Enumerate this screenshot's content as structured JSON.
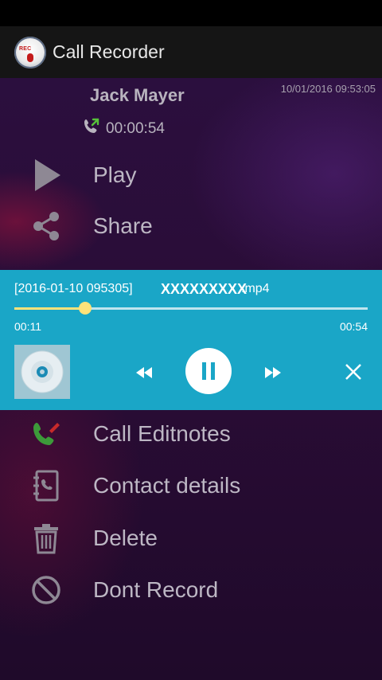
{
  "app": {
    "title": "Call Recorder",
    "logo_text": "REC"
  },
  "record": {
    "caller_name": "Jack Mayer",
    "timestamp": "10/01/2016 09:53:05",
    "duration": "00:00:54"
  },
  "menu": [
    {
      "label": "Play",
      "icon": "play-icon"
    },
    {
      "label": "Share",
      "icon": "share-icon"
    },
    {
      "label": "Call Editnotes",
      "icon": "call-notes-icon"
    },
    {
      "label": "Contact details",
      "icon": "contact-book-icon"
    },
    {
      "label": "Delete",
      "icon": "trash-icon"
    },
    {
      "label": "Dont Record",
      "icon": "block-icon"
    }
  ],
  "player": {
    "file_date": "[2016-01-10 095305]",
    "file_name": "XXXXXXXXX",
    "file_ext": ".mp4",
    "elapsed": "00:11",
    "total": "00:54",
    "progress": 0.2,
    "state": "playing"
  },
  "colors": {
    "player_bg": "#1aa6c7",
    "seek_accent": "#ffe27a",
    "app_bar": "#151515"
  }
}
